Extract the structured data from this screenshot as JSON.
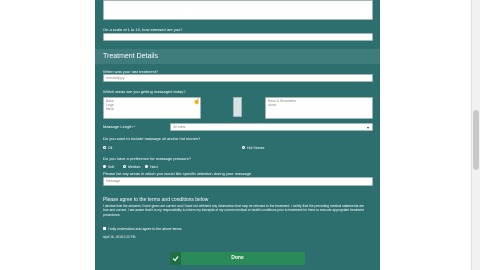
{
  "form": {
    "stress_question": "On a scale of 1 to 10, how stressed are you?",
    "section_title": "Treatment Details",
    "last_treatment_label": "When was your last treatment?",
    "last_treatment_placeholder": "mm/dd/yyyy",
    "areas_label": "Which areas are you getting massaged today?",
    "areas_left": [
      "Back",
      "Legs",
      "Neck"
    ],
    "areas_right": [
      "Back & Shoulders",
      "Arms"
    ],
    "massage_length_label": "Massage Length *",
    "massage_length_value": "30 mins",
    "hot_stones_label": "Do you want to include massage oil and/or hot stones?",
    "hot_stones_options": [
      "Oil",
      "Hot Stones"
    ],
    "pressure_label": "Do you have a preference for massage pressure?",
    "pressure_options": [
      "Soft",
      "Medium",
      "Hard"
    ],
    "attention_label": "Please list any areas in which you would like specific attention during your massage",
    "attention_placeholder": "Message",
    "terms_title": "Please agree to the terms and conditions below",
    "terms_text": "I declare that the answers I have given are correct and I have not withheld any information that may be relevant to the treatment. I certify that the preceding medical statements are true and correct. I am aware that it is my responsibility to inform my therapist of my current medical or health conditions prior to treatment for them to execute appropriate treatment procedures.",
    "agree_label": "I fully understand and agree to the above terms.",
    "timestamp": "April 16, 2018 2:22 PM",
    "done_label": "Done"
  }
}
